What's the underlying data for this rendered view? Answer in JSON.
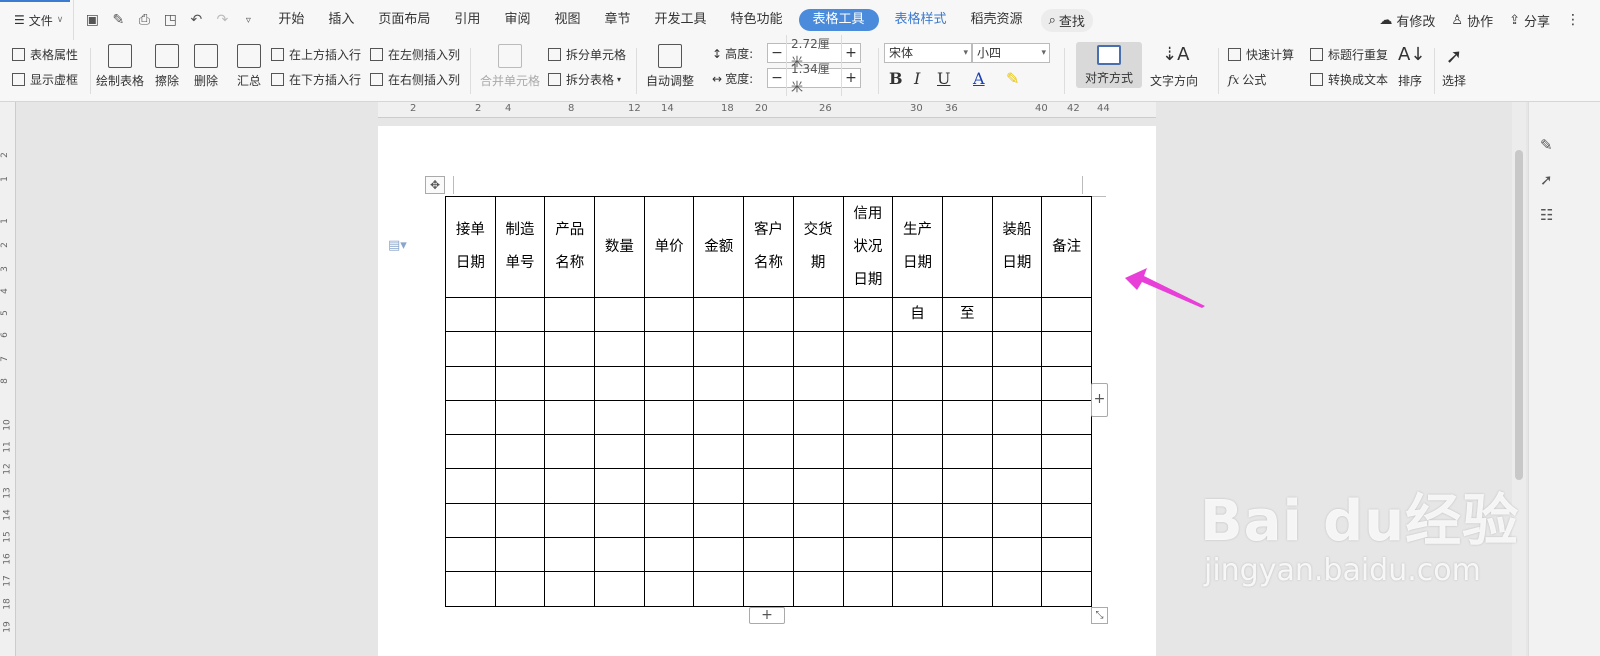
{
  "menubar": {
    "file_label": "文件",
    "tabs": [
      "开始",
      "插入",
      "页面布局",
      "引用",
      "审阅",
      "视图",
      "章节",
      "开发工具",
      "特色功能"
    ],
    "active_tab": "表格工具",
    "tab_style": "表格样式",
    "tab_resources": "稻壳资源",
    "search": "查找",
    "right": {
      "modified": "有修改",
      "collab": "协作",
      "share": "分享"
    }
  },
  "ribbon": {
    "table_props": "表格属性",
    "show_gridlines": "显示虚框",
    "draw_table": "绘制表格",
    "erase": "擦除",
    "delete": "删除",
    "summary": "汇总",
    "insert_above": "在上方插入行",
    "insert_below": "在下方插入行",
    "insert_left": "在左侧插入列",
    "insert_right": "在右侧插入列",
    "merge_cells": "合并单元格",
    "split_cells": "拆分单元格",
    "split_table": "拆分表格",
    "auto_fit": "自动调整",
    "height_label": "高度:",
    "height_value": "2.72厘米",
    "width_label": "宽度:",
    "width_value": "1.34厘米",
    "font_name": "宋体",
    "font_size": "小四",
    "align": "对齐方式",
    "text_direction": "文字方向",
    "quick_calc": "快速计算",
    "repeat_header": "标题行重复",
    "formula": "公式",
    "convert_text": "转换成文本",
    "sort": "排序",
    "select": "选择"
  },
  "ruler": {
    "h_ticks": [
      "2",
      "2",
      "4",
      "8",
      "12",
      "14",
      "18",
      "20",
      "26",
      "30",
      "36",
      "40",
      "42",
      "44"
    ],
    "v_ticks": [
      "2",
      "1",
      "1",
      "2",
      "3",
      "4",
      "5",
      "6",
      "7",
      "8",
      "10",
      "11",
      "12",
      "13",
      "14",
      "15",
      "16",
      "17",
      "18",
      "19"
    ]
  },
  "table": {
    "headers": [
      [
        "接单",
        "日期"
      ],
      [
        "制造",
        "单号"
      ],
      [
        "产品",
        "名称"
      ],
      [
        "数量"
      ],
      [
        "单价"
      ],
      [
        "金额"
      ],
      [
        "客户",
        "名称"
      ],
      [
        "交货",
        "期"
      ],
      [
        "信用",
        "状况",
        "日期"
      ],
      [
        "生产",
        "日期"
      ],
      [],
      [
        "装船",
        "日期"
      ],
      [
        "备注"
      ]
    ],
    "sub_row": {
      "from": "自",
      "to": "至"
    },
    "empty_rows": 9
  },
  "watermark": {
    "brand": "Bai du经验",
    "url": "jingyan.baidu.com"
  },
  "colors": {
    "accent": "#4a8bdb",
    "arrow": "#e83fd8"
  }
}
